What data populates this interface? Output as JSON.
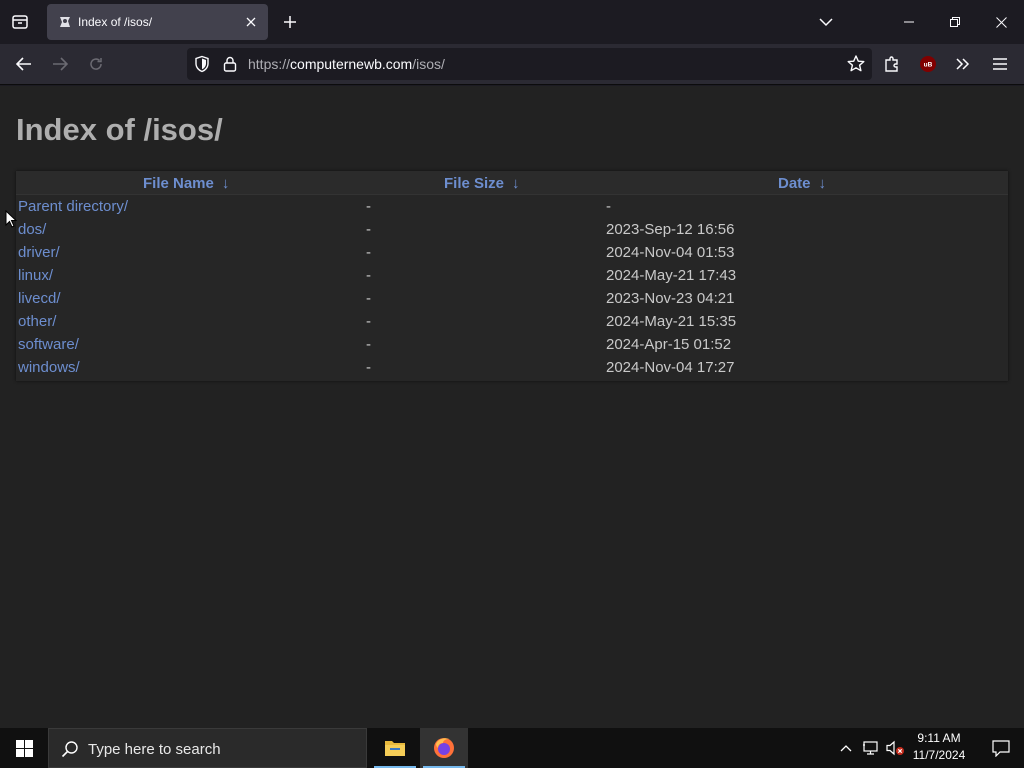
{
  "browser": {
    "tab": {
      "title": "Index of /isos/"
    },
    "url": {
      "scheme": "https://",
      "host": "computernewb.com",
      "path": "/isos/"
    }
  },
  "page": {
    "title": "Index of /isos/",
    "columns": [
      {
        "label": "File Name",
        "arrow": "↓"
      },
      {
        "label": "File Size",
        "arrow": "↓"
      },
      {
        "label": "Date",
        "arrow": "↓"
      }
    ],
    "rows": [
      {
        "name": "Parent directory/",
        "size": "-",
        "date": "-"
      },
      {
        "name": "dos/",
        "size": "-",
        "date": "2023-Sep-12 16:56"
      },
      {
        "name": "driver/",
        "size": "-",
        "date": "2024-Nov-04 01:53"
      },
      {
        "name": "linux/",
        "size": "-",
        "date": "2024-May-21 17:43"
      },
      {
        "name": "livecd/",
        "size": "-",
        "date": "2023-Nov-23 04:21"
      },
      {
        "name": "other/",
        "size": "-",
        "date": "2024-May-21 15:35"
      },
      {
        "name": "software/",
        "size": "-",
        "date": "2024-Apr-15 01:52"
      },
      {
        "name": "windows/",
        "size": "-",
        "date": "2024-Nov-04 17:27"
      }
    ]
  },
  "taskbar": {
    "search_placeholder": "Type here to search",
    "time": "9:11 AM",
    "date": "11/7/2024"
  },
  "colors": {
    "link": "#6d8ecf",
    "accent": "#76b9ed"
  }
}
